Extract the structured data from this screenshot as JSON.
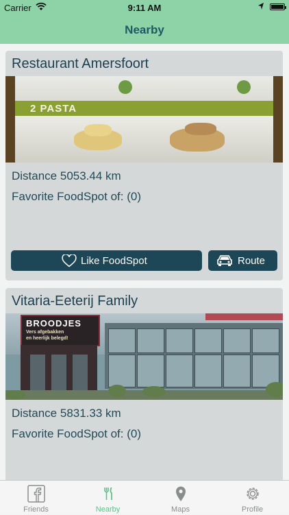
{
  "status_bar": {
    "carrier": "Carrier",
    "time": "9:11 AM"
  },
  "nav": {
    "title": "Nearby"
  },
  "spots": [
    {
      "name": "Restaurant Amersfoort",
      "distance": "Distance 5053.44 km",
      "favorite": "Favorite FoodSpot of: (0)",
      "photo_text": [
        "2 PASTA"
      ],
      "like_label": "Like FoodSpot",
      "route_label": "Route"
    },
    {
      "name": "Vitaria-Eeterij Family",
      "distance": "Distance 5831.33 km",
      "favorite": "Favorite FoodSpot of: (0)",
      "photo_text": [
        "BROODJES",
        "Vers afgebakken",
        "en heerlijk belegd!"
      ]
    }
  ],
  "tabs": [
    {
      "label": "Friends",
      "icon": "facebook-icon"
    },
    {
      "label": "Nearby",
      "icon": "fork-knife-icon",
      "active": true
    },
    {
      "label": "Maps",
      "icon": "map-pin-icon"
    },
    {
      "label": "Profile",
      "icon": "gear-icon"
    }
  ],
  "colors": {
    "header": "#8ed3a8",
    "title": "#1f5763",
    "card": "#d5d8d9",
    "button": "#1d4656",
    "tab_active": "#5ec088",
    "tab_inactive": "#8a8d8d"
  }
}
